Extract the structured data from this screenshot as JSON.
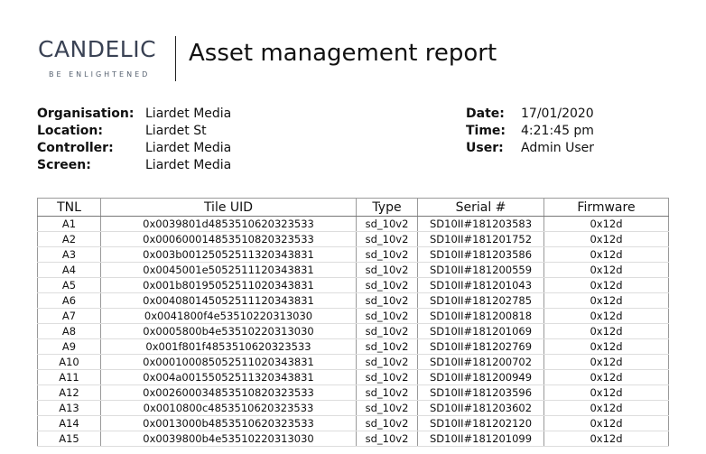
{
  "header": {
    "logo_word": "CANDELIC",
    "logo_tagline": "BE ENLIGHTENED",
    "title": "Asset management report"
  },
  "meta_left": [
    {
      "label": "Organisation:",
      "value": "Liardet Media"
    },
    {
      "label": "Location:",
      "value": "Liardet St"
    },
    {
      "label": "Controller:",
      "value": "Liardet Media"
    },
    {
      "label": "Screen:",
      "value": "Liardet Media"
    }
  ],
  "meta_right": [
    {
      "label": "Date:",
      "value": "17/01/2020"
    },
    {
      "label": "Time:",
      "value": "4:21:45 pm"
    },
    {
      "label": "User:",
      "value": "Admin User"
    }
  ],
  "table": {
    "columns": [
      "TNL",
      "Tile UID",
      "Type",
      "Serial #",
      "Firmware"
    ],
    "rows": [
      [
        "A1",
        "0x0039801d4853510620323533",
        "sd_10v2",
        "SD10II#181203583",
        "0x12d"
      ],
      [
        "A2",
        "0x0006000148535108 20323533",
        "sd_10v2",
        "SD10II#181201752",
        "0x12d"
      ],
      [
        "A3",
        "0x003b0012505251132034383l",
        "sd_10v2",
        "SD10II#181203586",
        "0x12d"
      ],
      [
        "A4",
        "0x0045001e5052511120343831",
        "sd_10v2",
        "SD10II#181200559",
        "0x12d"
      ],
      [
        "A5",
        "0x001b801950525110 20343831",
        "sd_10v2",
        "SD10II#181201043",
        "0x12d"
      ],
      [
        "A6",
        "0x0040801450525111 20343831",
        "sd_10v2",
        "SD10II#181202785",
        "0x12d"
      ],
      [
        "A7",
        "0x0041800f4e53510220313030",
        "sd_10v2",
        "SD10II#181200818",
        "0x12d"
      ],
      [
        "A8",
        "0x0005800b4e53510220313030",
        "sd_10v2",
        "SD10II#181201069",
        "0x12d"
      ],
      [
        "A9",
        "0x001f801f4853510620323533",
        "sd_10v2",
        "SD10II#181202769",
        "0x12d"
      ],
      [
        "A10",
        "0x0001000850525110 20343831",
        "sd_10v2",
        "SD10II#181200702",
        "0x12d"
      ],
      [
        "A11",
        "0x004a0015505251132034383l",
        "sd_10v2",
        "SD10II#181200949",
        "0x12d"
      ],
      [
        "A12",
        "0x0026000348535108 20323533",
        "sd_10v2",
        "SD10II#181203596",
        "0x12d"
      ],
      [
        "A13",
        "0x0010800c4853510620323533",
        "sd_10v2",
        "SD10II#181203602",
        "0x12d"
      ],
      [
        "A14",
        "0x0013000b4853510620323533",
        "sd_10v2",
        "SD10II#181202120",
        "0x12d"
      ],
      [
        "A15",
        "0x0039800b4e53510220313030",
        "sd_10v2",
        "SD10II#181201099",
        "0x12d"
      ]
    ]
  }
}
